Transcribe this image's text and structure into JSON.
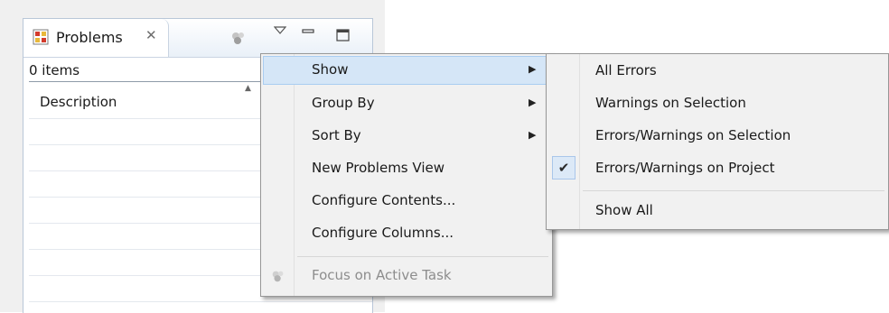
{
  "view": {
    "tab_label": "Problems",
    "tab_close_glyph": "✕",
    "tab_icon": "problems-icon",
    "header_buttons": [
      "focus-task-icon",
      "view-menu-icon",
      "minimize-icon",
      "maximize-icon"
    ],
    "items_count": "0 items",
    "column_header": "Description"
  },
  "menu": {
    "items": [
      {
        "label": "Show",
        "has_submenu": true,
        "highlighted": true
      },
      {
        "label": "Group By",
        "has_submenu": true
      },
      {
        "label": "Sort By",
        "has_submenu": true
      },
      {
        "label": "New Problems View"
      },
      {
        "label": "Configure Contents..."
      },
      {
        "label": "Configure Columns..."
      },
      {
        "label": "Focus on Active Task",
        "disabled": true,
        "icon": "focus-task-icon"
      }
    ]
  },
  "submenu": {
    "items": [
      {
        "label": "All Errors"
      },
      {
        "label": "Warnings on Selection"
      },
      {
        "label": "Errors/Warnings on Selection"
      },
      {
        "label": "Errors/Warnings on Project",
        "checked": true
      },
      {
        "label": "Show All"
      }
    ]
  },
  "colors": {
    "highlight_bg": "#d5e6f7",
    "highlight_border": "#a9cdf1",
    "menu_bg": "#f1f1f1",
    "disabled_text": "#8d8d8d"
  }
}
